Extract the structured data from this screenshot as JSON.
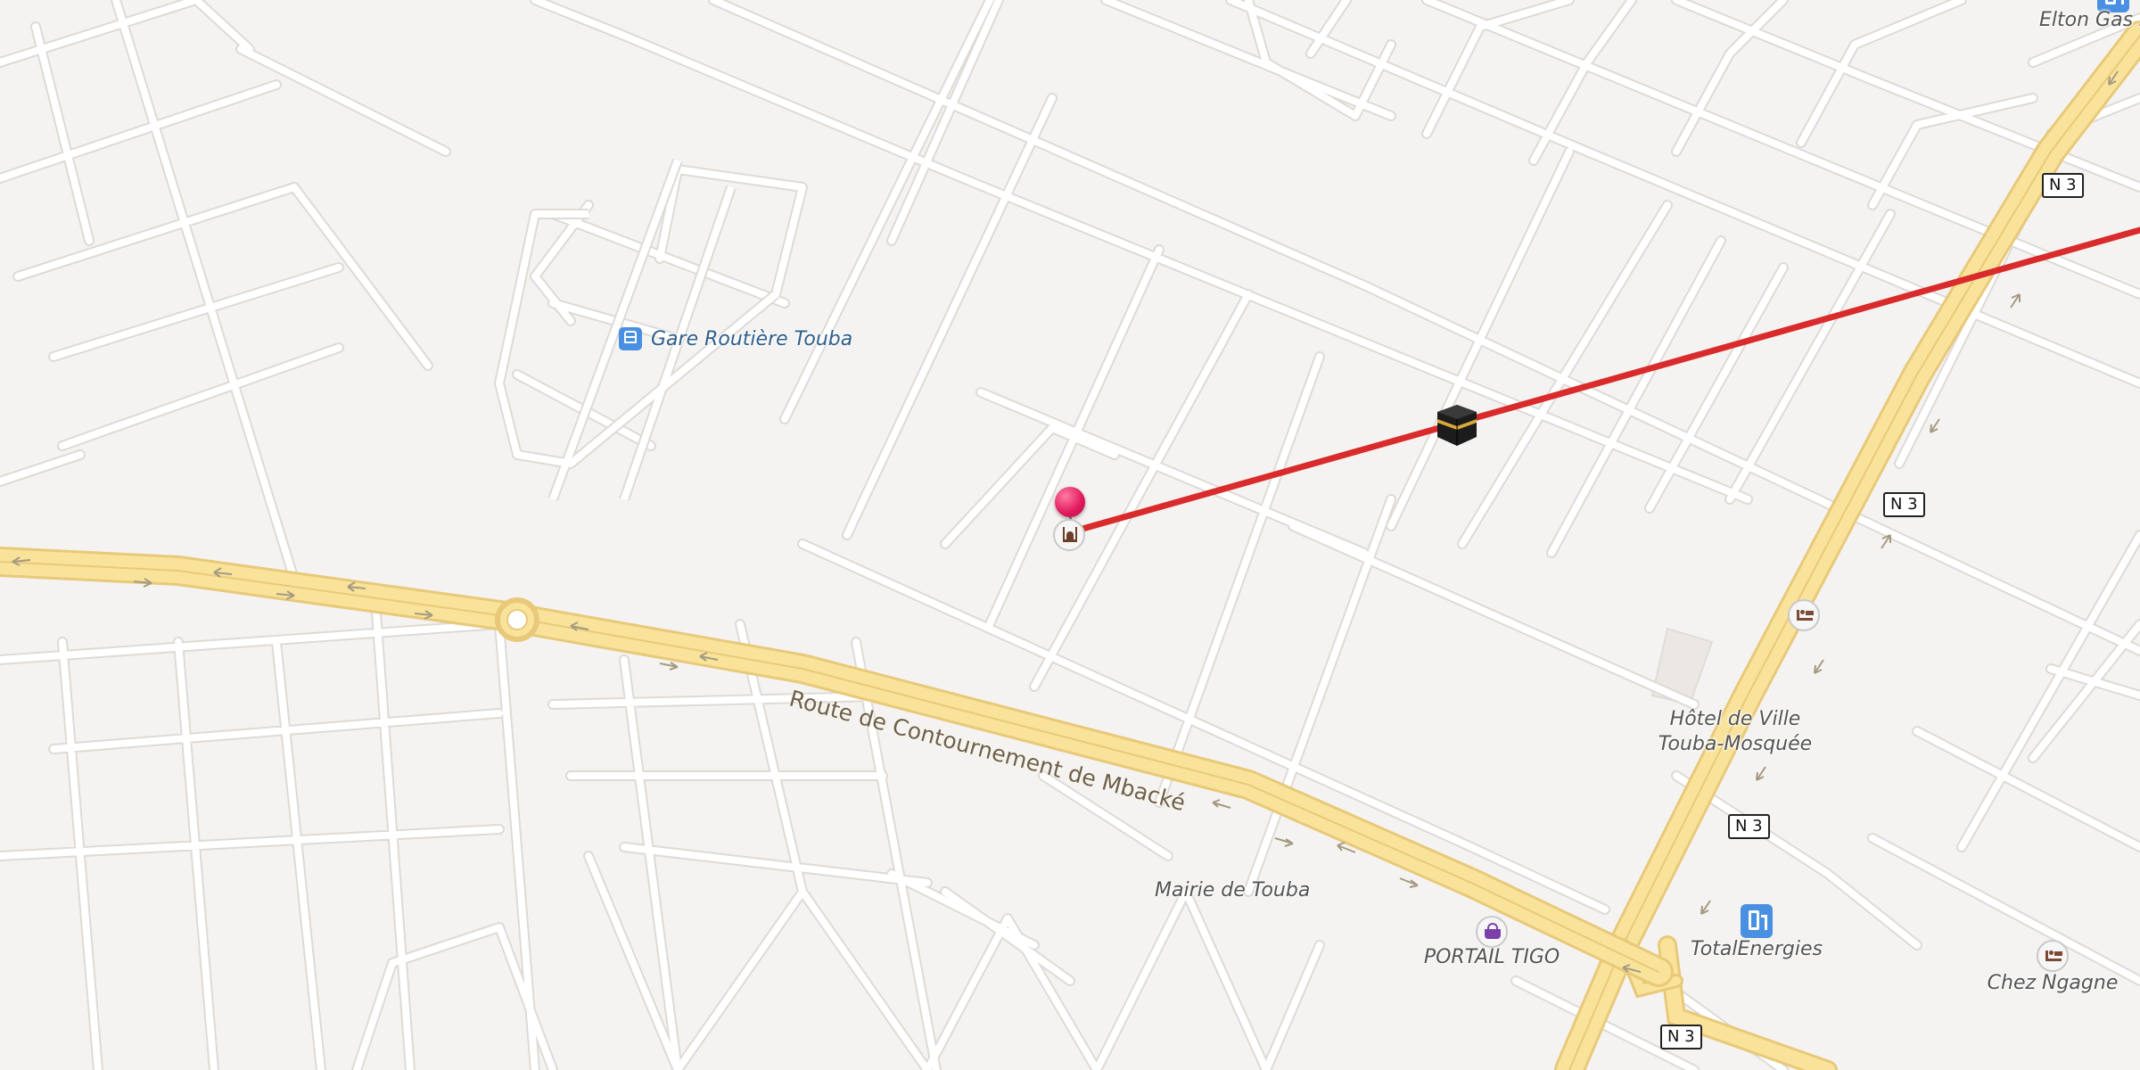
{
  "map": {
    "labels": {
      "bus_station": "Gare Routière Touba",
      "road_main": "Route de Contournement de Mbacké",
      "town_hall_1": "Hôtel de Ville",
      "town_hall_2": "Touba-Mosquée",
      "mairie": "Mairie de Touba",
      "shop": "PORTAIL TIGO",
      "fuel": "TotalEnergies",
      "hotel": "Chez Ngagne",
      "gas_top": "Elton Gas s"
    },
    "shields": [
      "N 3",
      "N 3",
      "N 3",
      "N 3"
    ],
    "icons": {
      "bus": "bus-icon",
      "fuel": "fuel-pump-icon",
      "fuel_top": "fuel-pump-icon",
      "hotel_1": "bed-icon",
      "hotel_2": "bed-icon",
      "shop": "shopping-basket-icon",
      "mosque": "mosque-icon",
      "pin": "location-pin-icon",
      "kaaba": "kaaba-icon"
    },
    "colors": {
      "background": "#f5f3f1",
      "road": "#ffffff",
      "road_outline": "#dcd8d3",
      "highway": "#f9e39a",
      "highway_outline": "#e8c97a",
      "qibla_line": "#d92b2b",
      "pin": "#e0185c"
    }
  }
}
